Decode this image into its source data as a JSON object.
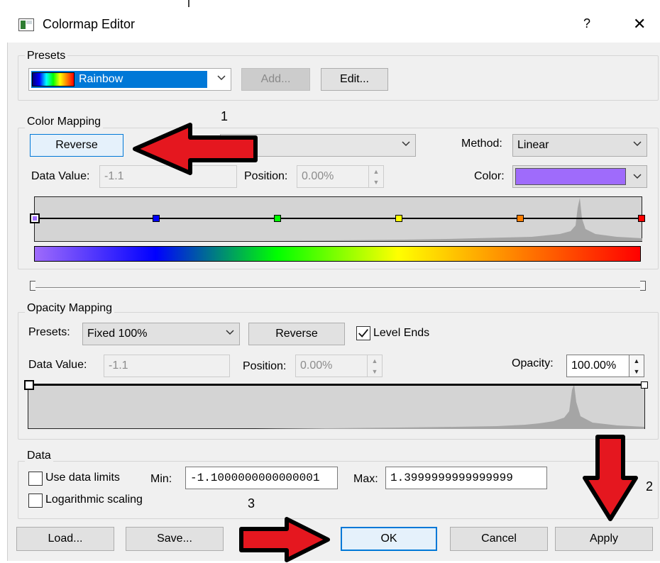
{
  "window": {
    "title": "Colormap Editor",
    "help": "?",
    "close": "✕"
  },
  "presets": {
    "group_label": "Presets",
    "selected": "Rainbow",
    "add_label": "Add...",
    "edit_label": "Edit..."
  },
  "color_mapping": {
    "group_label": "Color Mapping",
    "reverse_label": "Reverse",
    "method_label": "Method:",
    "method_value": "Linear",
    "data_value_label": "Data Value:",
    "data_value": "-1.1",
    "position_label": "Position:",
    "position_value": "0.00%",
    "color_label": "Color:",
    "color_value": "#9f6bfb",
    "node_colors": [
      "#9f6bfb",
      "#0000ff",
      "#00ff00",
      "#ffff00",
      "#ff7f00",
      "#ff0000"
    ]
  },
  "opacity_mapping": {
    "group_label": "Opacity Mapping",
    "presets_label": "Presets:",
    "presets_value": "Fixed 100%",
    "reverse_label": "Reverse",
    "level_ends_label": "Level Ends",
    "level_ends_checked": true,
    "data_value_label": "Data Value:",
    "data_value": "-1.1",
    "position_label": "Position:",
    "position_value": "0.00%",
    "opacity_label": "Opacity:",
    "opacity_value": "100.00%"
  },
  "data": {
    "group_label": "Data",
    "use_data_limits_label": "Use data limits",
    "use_data_limits_checked": false,
    "logarithmic_label": "Logarithmic scaling",
    "logarithmic_checked": false,
    "min_label": "Min:",
    "min_value": "-1.1000000000000001",
    "max_label": "Max:",
    "max_value": "1.3999999999999999"
  },
  "footer": {
    "load_label": "Load...",
    "save_label": "Save...",
    "ok_label": "OK",
    "cancel_label": "Cancel",
    "apply_label": "Apply"
  },
  "annotations": {
    "n1": "1",
    "n2": "2",
    "n3": "3",
    "arrow_color": "#e5171f"
  }
}
